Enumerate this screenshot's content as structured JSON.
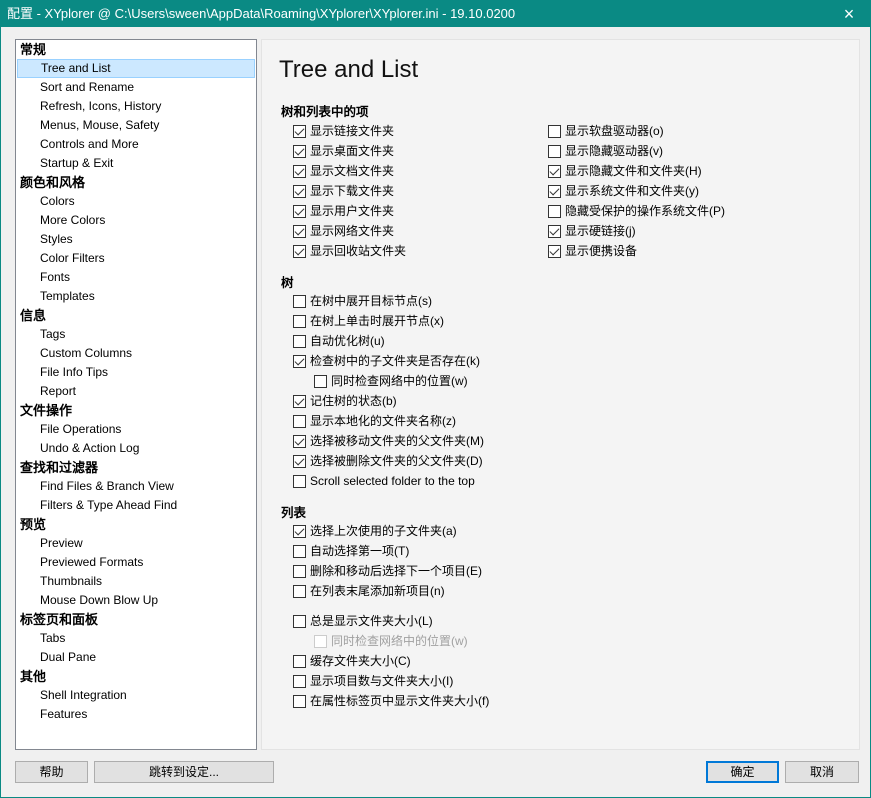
{
  "window": {
    "title": "配置 - XYplorer @ C:\\Users\\sween\\AppData\\Roaming\\XYplorer\\XYplorer.ini - 19.10.0200",
    "close_icon": "×"
  },
  "sidebar": {
    "items": [
      {
        "label": "常规",
        "type": "cat"
      },
      {
        "label": "Tree and List",
        "type": "sub",
        "selected": true
      },
      {
        "label": "Sort and Rename",
        "type": "sub"
      },
      {
        "label": "Refresh, Icons, History",
        "type": "sub"
      },
      {
        "label": "Menus, Mouse, Safety",
        "type": "sub"
      },
      {
        "label": "Controls and More",
        "type": "sub"
      },
      {
        "label": "Startup & Exit",
        "type": "sub"
      },
      {
        "label": "颜色和风格",
        "type": "cat"
      },
      {
        "label": "Colors",
        "type": "sub"
      },
      {
        "label": "More Colors",
        "type": "sub"
      },
      {
        "label": "Styles",
        "type": "sub"
      },
      {
        "label": "Color Filters",
        "type": "sub"
      },
      {
        "label": "Fonts",
        "type": "sub"
      },
      {
        "label": "Templates",
        "type": "sub"
      },
      {
        "label": "信息",
        "type": "cat"
      },
      {
        "label": "Tags",
        "type": "sub"
      },
      {
        "label": "Custom Columns",
        "type": "sub"
      },
      {
        "label": "File Info Tips",
        "type": "sub"
      },
      {
        "label": "Report",
        "type": "sub"
      },
      {
        "label": "文件操作",
        "type": "cat"
      },
      {
        "label": "File Operations",
        "type": "sub"
      },
      {
        "label": "Undo & Action Log",
        "type": "sub"
      },
      {
        "label": "查找和过滤器",
        "type": "cat"
      },
      {
        "label": "Find Files & Branch View",
        "type": "sub"
      },
      {
        "label": "Filters & Type Ahead Find",
        "type": "sub"
      },
      {
        "label": "预览",
        "type": "cat"
      },
      {
        "label": "Preview",
        "type": "sub"
      },
      {
        "label": "Previewed Formats",
        "type": "sub"
      },
      {
        "label": "Thumbnails",
        "type": "sub"
      },
      {
        "label": "Mouse Down Blow Up",
        "type": "sub"
      },
      {
        "label": "标签页和面板",
        "type": "cat"
      },
      {
        "label": "Tabs",
        "type": "sub"
      },
      {
        "label": "Dual Pane",
        "type": "sub"
      },
      {
        "label": "其他",
        "type": "cat"
      },
      {
        "label": "Shell Integration",
        "type": "sub"
      },
      {
        "label": "Features",
        "type": "sub"
      }
    ]
  },
  "main": {
    "title": "Tree and List",
    "sections": [
      {
        "heading": "树和列表中的项",
        "left": [
          {
            "label": "显示链接文件夹",
            "checked": true
          },
          {
            "label": "显示桌面文件夹",
            "checked": true
          },
          {
            "label": "显示文档文件夹",
            "checked": true
          },
          {
            "label": "显示下载文件夹",
            "checked": true
          },
          {
            "label": "显示用户文件夹",
            "checked": true
          },
          {
            "label": "显示网络文件夹",
            "checked": true
          },
          {
            "label": "显示回收站文件夹",
            "checked": true
          }
        ],
        "right": [
          {
            "label": "显示软盘驱动器(o)",
            "checked": false
          },
          {
            "label": "显示隐藏驱动器(v)",
            "checked": false
          },
          {
            "label": "显示隐藏文件和文件夹(H)",
            "checked": true
          },
          {
            "label": "显示系统文件和文件夹(y)",
            "checked": true
          },
          {
            "label": "隐藏受保护的操作系统文件(P)",
            "checked": false
          },
          {
            "label": "显示硬链接(j)",
            "checked": true
          },
          {
            "label": "显示便携设备",
            "checked": true
          }
        ]
      },
      {
        "heading": "树",
        "items": [
          {
            "label": "在树中展开目标节点(s)",
            "checked": false
          },
          {
            "label": "在树上单击时展开节点(x)",
            "checked": false
          },
          {
            "label": "自动优化树(u)",
            "checked": false
          },
          {
            "label": "检查树中的子文件夹是否存在(k)",
            "checked": true
          },
          {
            "label": "同时检查网络中的位置(w)",
            "checked": false,
            "indent": true
          },
          {
            "label": "记住树的状态(b)",
            "checked": true
          },
          {
            "label": "显示本地化的文件夹名称(z)",
            "checked": false
          },
          {
            "label": "选择被移动文件夹的父文件夹(M)",
            "checked": true
          },
          {
            "label": "选择被删除文件夹的父文件夹(D)",
            "checked": true
          },
          {
            "label": "Scroll selected folder to the top",
            "checked": false
          }
        ]
      },
      {
        "heading": "列表",
        "items": [
          {
            "label": "选择上次使用的子文件夹(a)",
            "checked": true
          },
          {
            "label": "自动选择第一项(T)",
            "checked": false
          },
          {
            "label": "删除和移动后选择下一个项目(E)",
            "checked": false
          },
          {
            "label": "在列表末尾添加新项目(n)",
            "checked": false
          },
          {
            "label": "总是显示文件夹大小(L)",
            "checked": false,
            "gap": true
          },
          {
            "label": "同时检查网络中的位置(w)",
            "checked": false,
            "indent": true,
            "disabled": true
          },
          {
            "label": "缓存文件夹大小(C)",
            "checked": false
          },
          {
            "label": "显示项目数与文件夹大小(I)",
            "checked": false
          },
          {
            "label": "在属性标签页中显示文件夹大小(f)",
            "checked": false
          }
        ]
      }
    ]
  },
  "buttons": {
    "help": "帮助",
    "goto": "跳转到设定...",
    "ok": "确定",
    "cancel": "取消"
  },
  "colors": {
    "titlebar": "#0a8a84",
    "selection": "#cce8ff",
    "default_button_border": "#0078d7"
  }
}
